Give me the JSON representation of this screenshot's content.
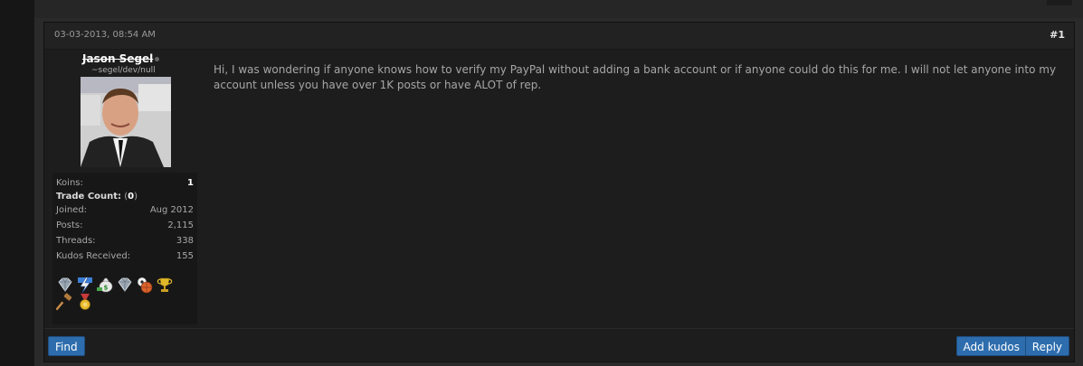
{
  "post": {
    "date": "03-03-2013, 08:54 AM",
    "number": "#1",
    "message": "Hi, I was wondering if anyone knows how to verify my PayPal without adding a bank account or if anyone could do this for me. I will not let anyone into my account unless you have over 1K posts or have ALOT of rep."
  },
  "user": {
    "name": "Jason Segel",
    "title": "~segel/dev/null",
    "online_status": "offline",
    "stats": {
      "koins_label": "Koins:",
      "koins_value": "1",
      "trade_label": "Trade Count:",
      "trade_open": "(",
      "trade_value": "0",
      "trade_close": ")",
      "joined_label": "Joined:",
      "joined_value": "Aug 2012",
      "posts_label": "Posts:",
      "posts_value": "2,115",
      "threads_label": "Threads:",
      "threads_value": "338",
      "kudos_label": "Kudos Received:",
      "kudos_value": "155"
    },
    "badges": [
      "diamond-icon",
      "lightning-icon",
      "money-bag-icon",
      "diamond-icon",
      "sports-balls-icon",
      "trophy-icon",
      "gavel-icon",
      "medal-icon"
    ]
  },
  "footer": {
    "find_label": "Find",
    "kudos_label": "Add kudos",
    "reply_label": "Reply"
  },
  "colors": {
    "button": "#2d6dad",
    "background": "#1d1d1d"
  }
}
